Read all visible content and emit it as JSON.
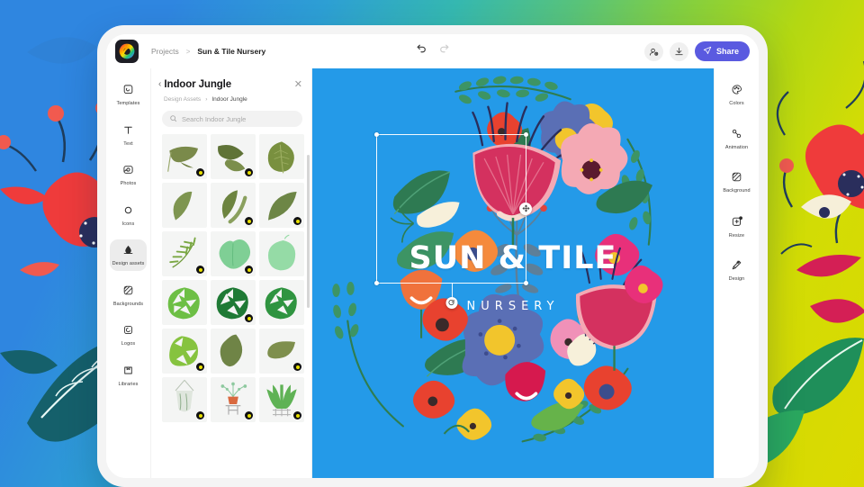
{
  "app": {
    "logo_name": "adobe-express-logo",
    "breadcrumb": {
      "parent": "Projects",
      "separator": ">",
      "current": "Sun & Tile Nursery"
    },
    "undo_label": "Undo",
    "redo_label": "Redo"
  },
  "topbar": {
    "invite_label": "Invite",
    "download_label": "Download",
    "share_label": "Share"
  },
  "left_rail": {
    "items": [
      {
        "label": "Templates",
        "icon": "templates-icon",
        "active": false
      },
      {
        "label": "Text",
        "icon": "text-icon",
        "active": false
      },
      {
        "label": "Photos",
        "icon": "photos-icon",
        "active": false
      },
      {
        "label": "Icons",
        "icon": "icons-icon",
        "active": false
      },
      {
        "label": "Design assets",
        "icon": "design-assets-icon",
        "active": true
      },
      {
        "label": "Backgrounds",
        "icon": "backgrounds-icon",
        "active": false
      },
      {
        "label": "Logos",
        "icon": "logos-icon",
        "active": false
      },
      {
        "label": "Libraries",
        "icon": "libraries-icon",
        "active": false
      }
    ]
  },
  "panel": {
    "back_chevron": "‹",
    "title": "Indoor Jungle",
    "close": "✕",
    "breadcrumb_parent": "Design Assets",
    "breadcrumb_sep": "›",
    "breadcrumb_current": "Indoor Jungle",
    "search_placeholder": "Search Indoor Jungle",
    "assets": [
      {
        "name": "banana-leaf-olive",
        "premium": true
      },
      {
        "name": "split-banana-leaf",
        "premium": true
      },
      {
        "name": "oval-veined-leaf",
        "premium": false
      },
      {
        "name": "slim-curved-leaf",
        "premium": false
      },
      {
        "name": "double-slim-leaf",
        "premium": true
      },
      {
        "name": "long-pointed-leaf",
        "premium": true
      },
      {
        "name": "fern-frond",
        "premium": true
      },
      {
        "name": "heart-leaf-pair",
        "premium": true
      },
      {
        "name": "pale-round-leaf",
        "premium": false
      },
      {
        "name": "monstera-light",
        "premium": false
      },
      {
        "name": "monstera-dark",
        "premium": true
      },
      {
        "name": "monstera-medium",
        "premium": false
      },
      {
        "name": "monstera-split",
        "premium": true
      },
      {
        "name": "olive-pointed-leaf",
        "premium": false
      },
      {
        "name": "small-olive-leaf",
        "premium": true
      },
      {
        "name": "hanging-planter",
        "premium": true
      },
      {
        "name": "potted-plant-stand",
        "premium": true
      },
      {
        "name": "snake-plant",
        "premium": true
      }
    ]
  },
  "right_rail": {
    "items": [
      {
        "label": "Colors",
        "icon": "colors-icon"
      },
      {
        "label": "Animation",
        "icon": "animation-icon"
      },
      {
        "label": "Background",
        "icon": "background-icon"
      },
      {
        "label": "Resize",
        "icon": "resize-icon"
      },
      {
        "label": "Design",
        "icon": "design-wand-icon"
      }
    ]
  },
  "canvas": {
    "background_color": "#249ae8",
    "title_text": "SUN & TILE",
    "subtitle_text": "NURSERY",
    "selection": {
      "element_name": "pink-flower-graphic",
      "rotate_handle": "rotate-handle",
      "move_handle": "move-handle"
    }
  },
  "colors": {
    "share_purple": "#5a5ae0",
    "canvas_blue": "#249ae8",
    "panel_bg": "#ffffff",
    "rail_active": "#ececec"
  }
}
